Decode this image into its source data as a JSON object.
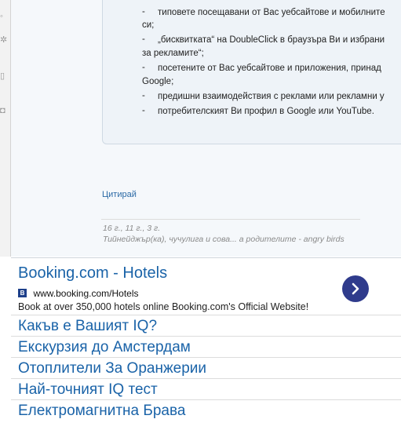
{
  "quote": {
    "lines": [
      "типовете посещавани от Вас уебсайтове и мобилните",
      "си;",
      "„бисквитката“ на DoubleClick в браузъра Ви и избрани",
      "за рекламите“;",
      "посетените от Вас уебсайтове и приложения, принад",
      "Google;",
      "предишни взаимодействия с реклами или рекламни у",
      "потребителският Ви профил в Google или YouTube."
    ],
    "dash": "-"
  },
  "post": {
    "quote_link": "Цитирай",
    "signature_line1": "16 г., 11 г., 3 г.",
    "signature_line2": "Тийнейджър(ка), чучулига и сова... а родителите - angry birds"
  },
  "ads": {
    "main": {
      "title": "Booking.com - Hotels",
      "favicon": "B",
      "url": "www.booking.com/Hotels",
      "description": "Book at over 350,000 hotels online Booking.com's Official Website!"
    },
    "links": [
      "Какъв е Вашият IQ?",
      "Екскурзия до Амстердам",
      "Отоплители За Оранжерии",
      "Най-точният IQ тест",
      "Електромагнитна Брава"
    ]
  }
}
